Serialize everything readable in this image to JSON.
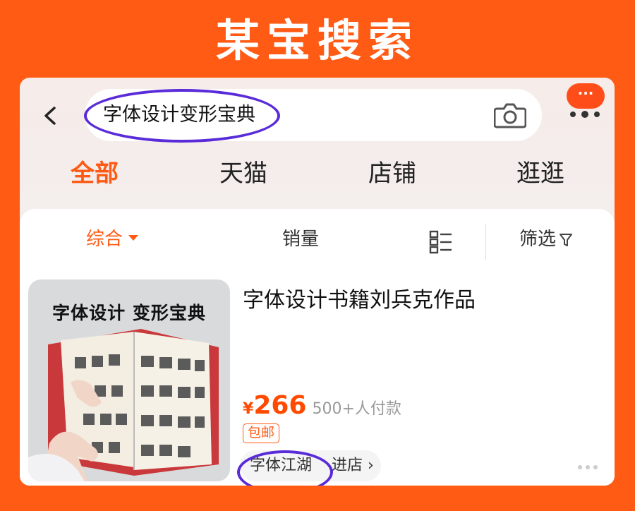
{
  "banner": {
    "title": "某宝搜索"
  },
  "search": {
    "query": "字体设计变形宝典",
    "more_badge": "···"
  },
  "tabs": [
    {
      "label": "全部",
      "active": true
    },
    {
      "label": "天猫",
      "active": false
    },
    {
      "label": "店铺",
      "active": false
    },
    {
      "label": "逛逛",
      "active": false
    }
  ],
  "sortbar": {
    "comprehensive": "综合",
    "sales": "销量",
    "filter": "筛选"
  },
  "product": {
    "image_title": "字体设计 变形宝典",
    "title": "字体设计书籍刘兵克作品",
    "price_symbol": "¥",
    "price": "266",
    "sales": "500+人付款",
    "badge": "包邮",
    "shop_name": "字体江湖",
    "shop_enter": "进店 ›"
  },
  "colors": {
    "accent": "#ff5a14",
    "annotation": "#5a2bd8"
  }
}
